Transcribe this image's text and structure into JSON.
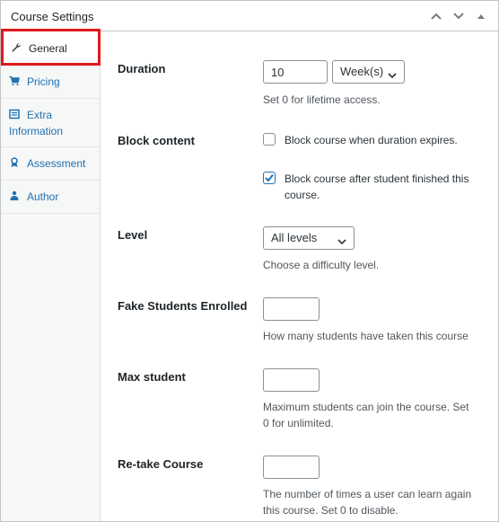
{
  "header": {
    "title": "Course Settings",
    "icons": [
      "chevron-up-icon",
      "chevron-down-icon",
      "triangle-up-icon"
    ]
  },
  "sidebar": {
    "items": [
      {
        "label": "General",
        "icon": "wrench-icon"
      },
      {
        "label": "Pricing",
        "icon": "cart-icon"
      },
      {
        "label": "Extra Information",
        "label_line1": "Extra",
        "label_line2": "Information",
        "icon": "card-icon"
      },
      {
        "label": "Assessment",
        "icon": "award-icon"
      },
      {
        "label": "Author",
        "icon": "users-icon"
      }
    ],
    "active": "General"
  },
  "fields": {
    "duration": {
      "label": "Duration",
      "value": "10",
      "unit": "Week(s)",
      "desc": "Set 0 for lifetime access."
    },
    "block": {
      "label": "Block content",
      "opt1": {
        "label": "Block course when duration expires.",
        "checked": false
      },
      "opt2": {
        "label_line1": "Block course after student finished this",
        "label_line2": "course.",
        "checked": true
      }
    },
    "level": {
      "label": "Level",
      "value": "All levels",
      "desc": "Choose a difficulty level."
    },
    "fake": {
      "label": "Fake Students Enrolled",
      "value": "",
      "desc": "How many students have taken this course"
    },
    "max": {
      "label": "Max student",
      "value": "",
      "desc_line1": "Maximum students can join the course. Set",
      "desc_line2": "0 for unlimited."
    },
    "retake": {
      "label": "Re-take Course",
      "value": "",
      "desc_line1": "The number of times a user can learn again",
      "desc_line2": "this course. Set 0 to disable."
    }
  },
  "colors": {
    "link": "#2271b1",
    "highlight": "#e0191e",
    "border": "#c3c4c7"
  }
}
